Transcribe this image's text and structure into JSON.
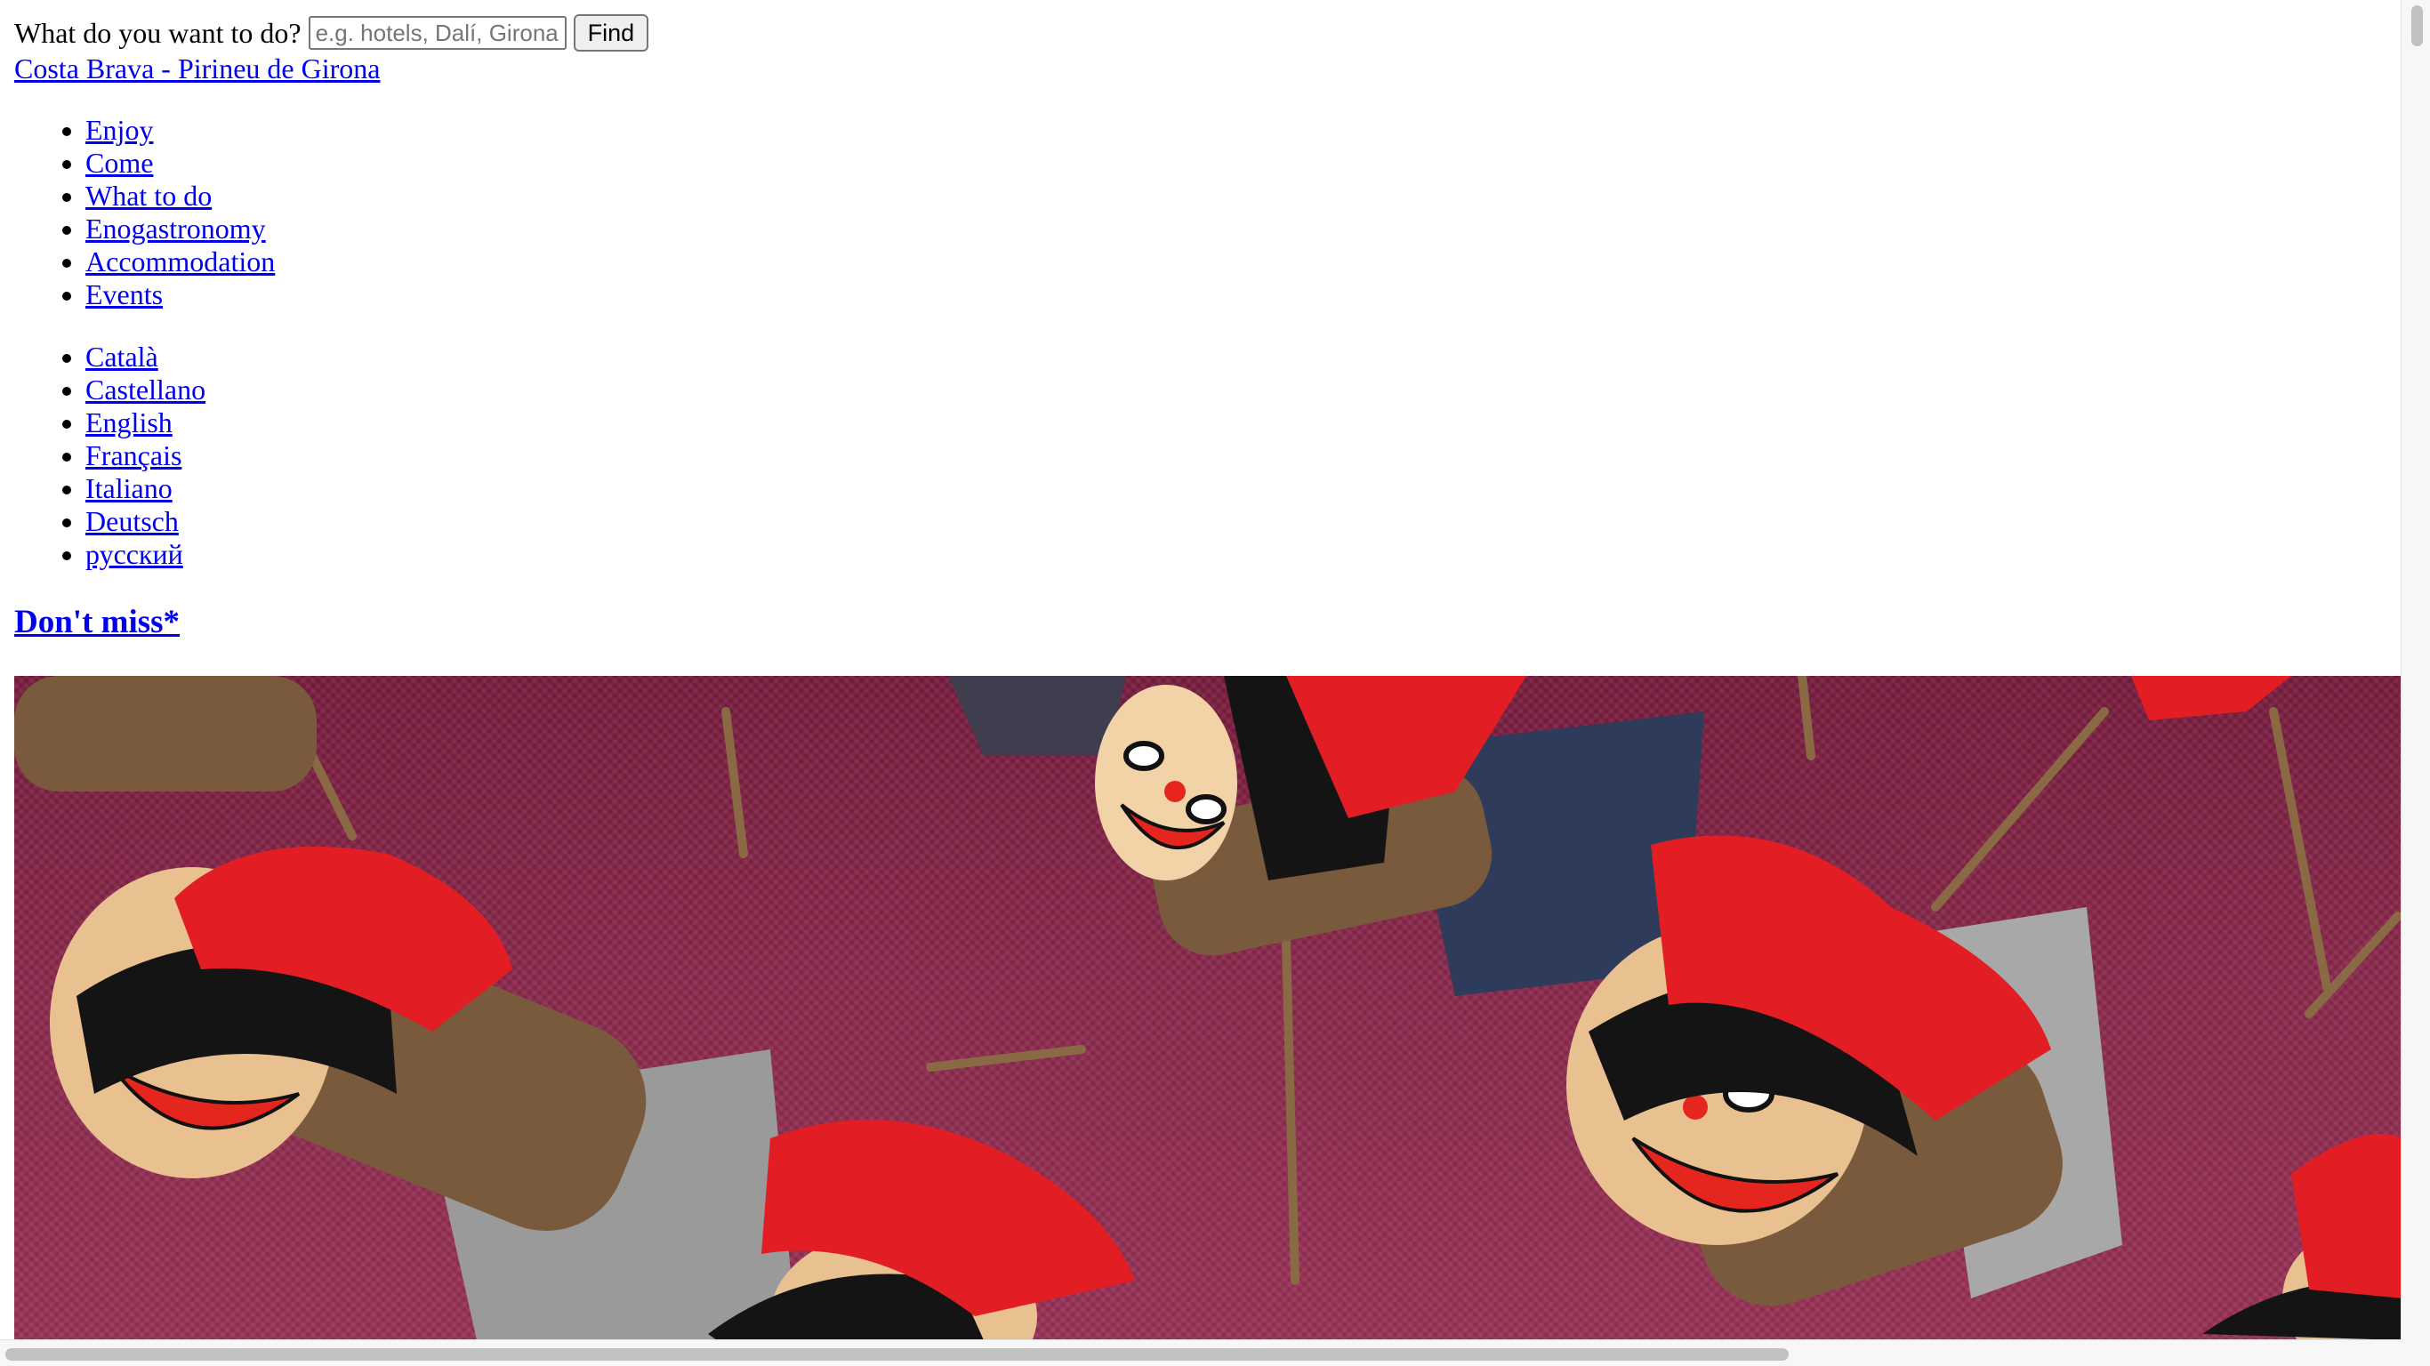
{
  "search": {
    "label": "What do you want to do?",
    "placeholder": "e.g. hotels, Dalí, Girona",
    "value": "",
    "button_label": "Find"
  },
  "site_link": "Costa Brava - Pirineu de Girona",
  "main_nav": [
    {
      "label": "Enjoy"
    },
    {
      "label": "Come"
    },
    {
      "label": "What to do"
    },
    {
      "label": "Enogastronomy"
    },
    {
      "label": "Accommodation"
    },
    {
      "label": "Events"
    }
  ],
  "languages": [
    {
      "label": "Català"
    },
    {
      "label": "Castellano"
    },
    {
      "label": "English"
    },
    {
      "label": "Français"
    },
    {
      "label": "Italiano"
    },
    {
      "label": "Deutsch"
    },
    {
      "label": "русский"
    }
  ],
  "featured": {
    "heading": "Don't miss*"
  },
  "colors": {
    "link": "#0000ee",
    "hero_cloth": "#8c2a4e",
    "hat_red": "#e02020"
  }
}
